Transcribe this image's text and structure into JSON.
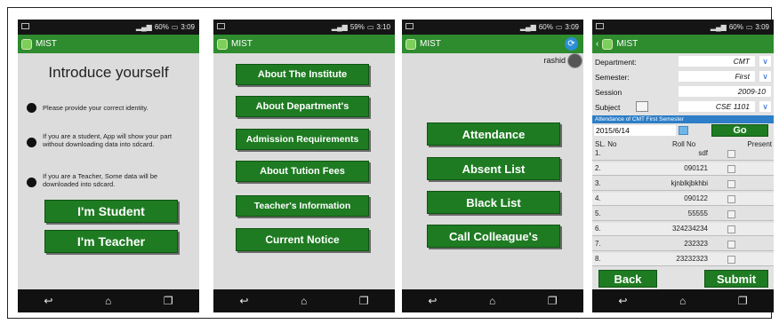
{
  "phones": [
    {
      "status": {
        "time": "3:09",
        "battery": "60%"
      },
      "appbar": {
        "title": "MIST"
      },
      "intro": {
        "title": "Introduce yourself",
        "bullets": [
          "Please provide your correct identity.",
          "If you are a student, App will show your part without downloading data into sdcard.",
          "If you are a Teacher, Some data will be downloaded into sdcard."
        ],
        "buttons": [
          "I'm Student",
          "I'm Teacher"
        ]
      }
    },
    {
      "status": {
        "time": "3:10",
        "battery": "59%"
      },
      "appbar": {
        "title": "MIST"
      },
      "menu": [
        "About The Institute",
        "About Department's",
        "Admission Requirements",
        "About Tution Fees",
        "Teacher's Information",
        "Current Notice"
      ]
    },
    {
      "status": {
        "time": "3:09",
        "battery": "60%"
      },
      "appbar": {
        "title": "MIST"
      },
      "user": "rashid",
      "menu": [
        "Attendance",
        "Absent List",
        "Black List",
        "Call Colleague's"
      ]
    },
    {
      "status": {
        "time": "3:09",
        "battery": "60%"
      },
      "appbar": {
        "title": "MIST"
      },
      "form": {
        "department": {
          "label": "Department:",
          "value": "CMT"
        },
        "semester": {
          "label": "Semester:",
          "value": "First"
        },
        "session": {
          "label": "Session",
          "value": "2009-10"
        },
        "subject": {
          "label": "Subject",
          "value": "CSE 1101"
        }
      },
      "attendance": {
        "caption": "Attendance of CMT  First Semester",
        "date": "2015/6/14",
        "go_label": "Go",
        "headers": [
          "SL. No",
          "Roll No",
          "Present"
        ],
        "rows": [
          {
            "sl": "1.",
            "roll": "sdf"
          },
          {
            "sl": "2.",
            "roll": "090121"
          },
          {
            "sl": "3.",
            "roll": "kjnblkjbkhbi"
          },
          {
            "sl": "4.",
            "roll": "090122"
          },
          {
            "sl": "5.",
            "roll": "55555"
          },
          {
            "sl": "6.",
            "roll": "324234234"
          },
          {
            "sl": "7.",
            "roll": "232323"
          },
          {
            "sl": "8.",
            "roll": "23232323"
          }
        ],
        "back_label": "Back",
        "submit_label": "Submit"
      }
    }
  ],
  "nav_icons": {
    "back": "back-icon",
    "home": "home-icon",
    "recent": "recent-apps-icon"
  },
  "colors": {
    "primary": "#2e8b2e",
    "button": "#1e7b22",
    "accent": "#2a66d6"
  }
}
